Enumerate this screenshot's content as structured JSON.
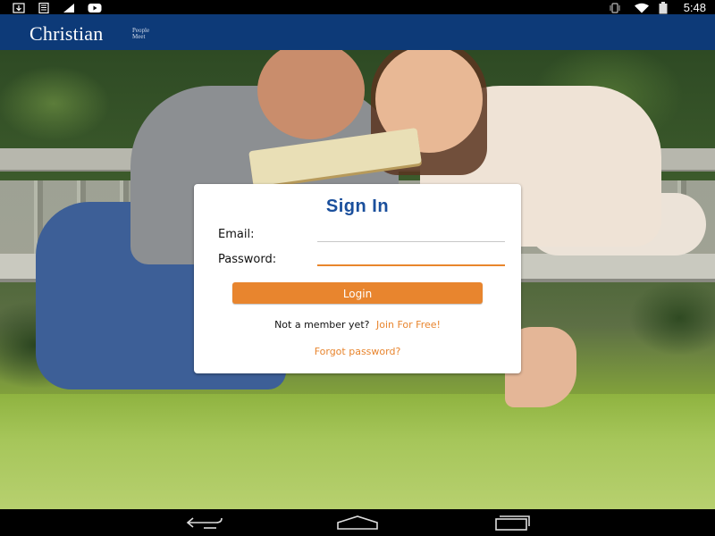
{
  "status_bar": {
    "time": "5:48",
    "left_icons": [
      "download-icon",
      "sim-card-icon",
      "signal-boost-icon",
      "youtube-icon"
    ],
    "right_icons": [
      "vibrate-icon",
      "wifi-icon",
      "battery-icon"
    ]
  },
  "app_bar": {
    "logo_text": "Christian",
    "logo_tagline": "People Meet"
  },
  "signin": {
    "title": "Sign In",
    "email_label": "Email:",
    "email_value": "",
    "password_label": "Password:",
    "password_value": "",
    "login_label": "Login",
    "member_prompt": "Not a member yet?",
    "join_link": "Join For Free!",
    "forgot_link": "Forgot password?"
  },
  "nav_bar": {
    "buttons": [
      "back-icon",
      "home-icon",
      "recent-apps-icon"
    ]
  },
  "colors": {
    "app_bar": "#0d3a78",
    "accent": "#e8852e",
    "title": "#1a4f9c"
  }
}
